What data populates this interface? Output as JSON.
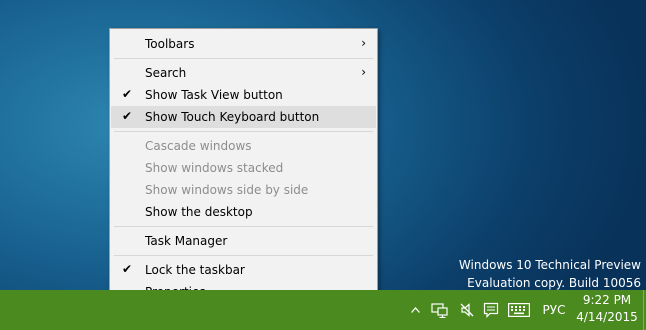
{
  "context_menu": {
    "items": [
      {
        "label": "Toolbars",
        "checked": false,
        "submenu": true,
        "enabled": true
      },
      {
        "label": "Search",
        "checked": false,
        "submenu": true,
        "enabled": true
      },
      {
        "label": "Show Task View button",
        "checked": true,
        "submenu": false,
        "enabled": true
      },
      {
        "label": "Show Touch Keyboard button",
        "checked": true,
        "submenu": false,
        "enabled": true,
        "highlighted": true
      },
      {
        "label": "Cascade windows",
        "checked": false,
        "submenu": false,
        "enabled": false
      },
      {
        "label": "Show windows stacked",
        "checked": false,
        "submenu": false,
        "enabled": false
      },
      {
        "label": "Show windows side by side",
        "checked": false,
        "submenu": false,
        "enabled": false
      },
      {
        "label": "Show the desktop",
        "checked": false,
        "submenu": false,
        "enabled": true
      },
      {
        "label": "Task Manager",
        "checked": false,
        "submenu": false,
        "enabled": true
      },
      {
        "label": "Lock the taskbar",
        "checked": true,
        "submenu": false,
        "enabled": true
      },
      {
        "label": "Properties",
        "checked": false,
        "submenu": false,
        "enabled": true
      }
    ],
    "check_glyph": "✔",
    "submenu_glyph": "›"
  },
  "watermark": {
    "line1": "Windows 10 Technical Preview",
    "line2": "Evaluation copy. Build 10056"
  },
  "tray": {
    "icons": [
      "chevron-up-icon",
      "network-icon",
      "volume-muted-icon",
      "action-center-icon",
      "touch-keyboard-icon"
    ],
    "language": "РУС",
    "time": "9:22 PM",
    "date": "4/14/2015"
  },
  "colors": {
    "taskbar": "#4a8a1f",
    "menu_bg": "#f2f2f2",
    "menu_highlight": "#dedede",
    "disabled_text": "#8d8d8d"
  }
}
